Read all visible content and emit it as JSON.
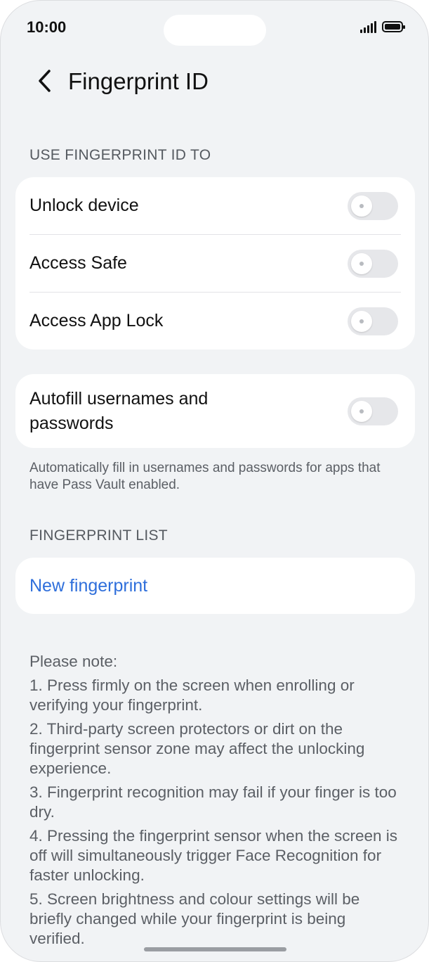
{
  "status_bar": {
    "time": "10:00"
  },
  "header": {
    "title": "Fingerprint ID",
    "back_icon": "chevron-left-icon"
  },
  "use_section": {
    "label": "USE FINGERPRINT ID TO",
    "items": [
      {
        "label": "Unlock device",
        "enabled": false
      },
      {
        "label": "Access Safe",
        "enabled": false
      },
      {
        "label": "Access App Lock",
        "enabled": false
      }
    ]
  },
  "autofill": {
    "label_line1": "Autofill usernames and",
    "label_line2": "passwords",
    "enabled": false,
    "description": "Automatically fill in usernames and passwords for apps that have Pass Vault enabled."
  },
  "fingerprint_list": {
    "label": "FINGERPRINT LIST",
    "new_label": "New fingerprint"
  },
  "notes": {
    "heading": "Please note:",
    "items": [
      "1. Press firmly on the screen when enrolling or verifying your fingerprint.",
      "2. Third-party screen protectors or dirt on the fingerprint sensor zone may affect the unlocking experience.",
      "3. Fingerprint recognition may fail if your finger is too dry.",
      "4. Pressing the fingerprint sensor when the screen is off will simultaneously trigger Face Recognition for faster unlocking.",
      "5. Screen brightness and colour settings will be briefly changed while your fingerprint is being verified."
    ]
  },
  "colors": {
    "accent": "#2f6fdb",
    "background": "#f1f3f5",
    "card": "#ffffff"
  }
}
